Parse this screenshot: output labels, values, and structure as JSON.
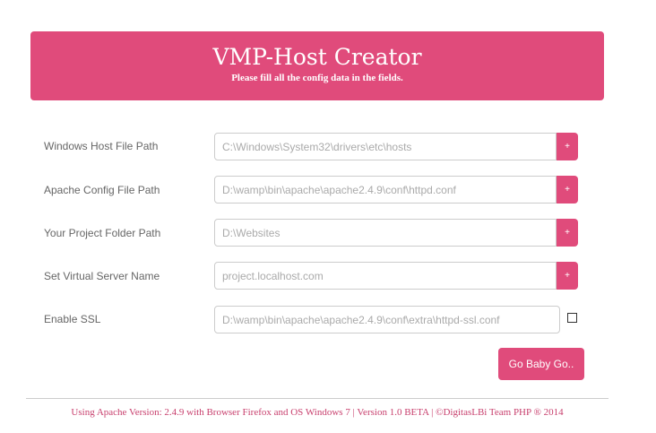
{
  "header": {
    "title": "VMP-Host Creator",
    "subtitle": "Please fill all the config data in the fields."
  },
  "form": {
    "rows": [
      {
        "label": "Windows Host File Path",
        "placeholder": "C:\\Windows\\System32\\drivers\\etc\\hosts",
        "button": "+"
      },
      {
        "label": "Apache Config File Path",
        "placeholder": "D:\\wamp\\bin\\apache\\apache2.4.9\\conf\\httpd.conf",
        "button": "+"
      },
      {
        "label": "Your Project Folder Path",
        "placeholder": "D:\\Websites",
        "button": "+"
      },
      {
        "label": "Set Virtual Server Name",
        "placeholder": "project.localhost.com",
        "button": "+"
      },
      {
        "label": "Enable SSL",
        "placeholder": "D:\\wamp\\bin\\apache\\apache2.4.9\\conf\\extra\\httpd-ssl.conf",
        "checked": false
      }
    ],
    "submit_label": "Go Baby Go.."
  },
  "footer": {
    "text": "Using Apache Version: 2.4.9 with Browser Firefox and OS Windows 7 | Version 1.0 BETA | ©DigitasLBi Team PHP ® 2014"
  },
  "colors": {
    "accent": "#e04b7b",
    "footer_text": "#c8406e",
    "label_text": "#666666"
  }
}
